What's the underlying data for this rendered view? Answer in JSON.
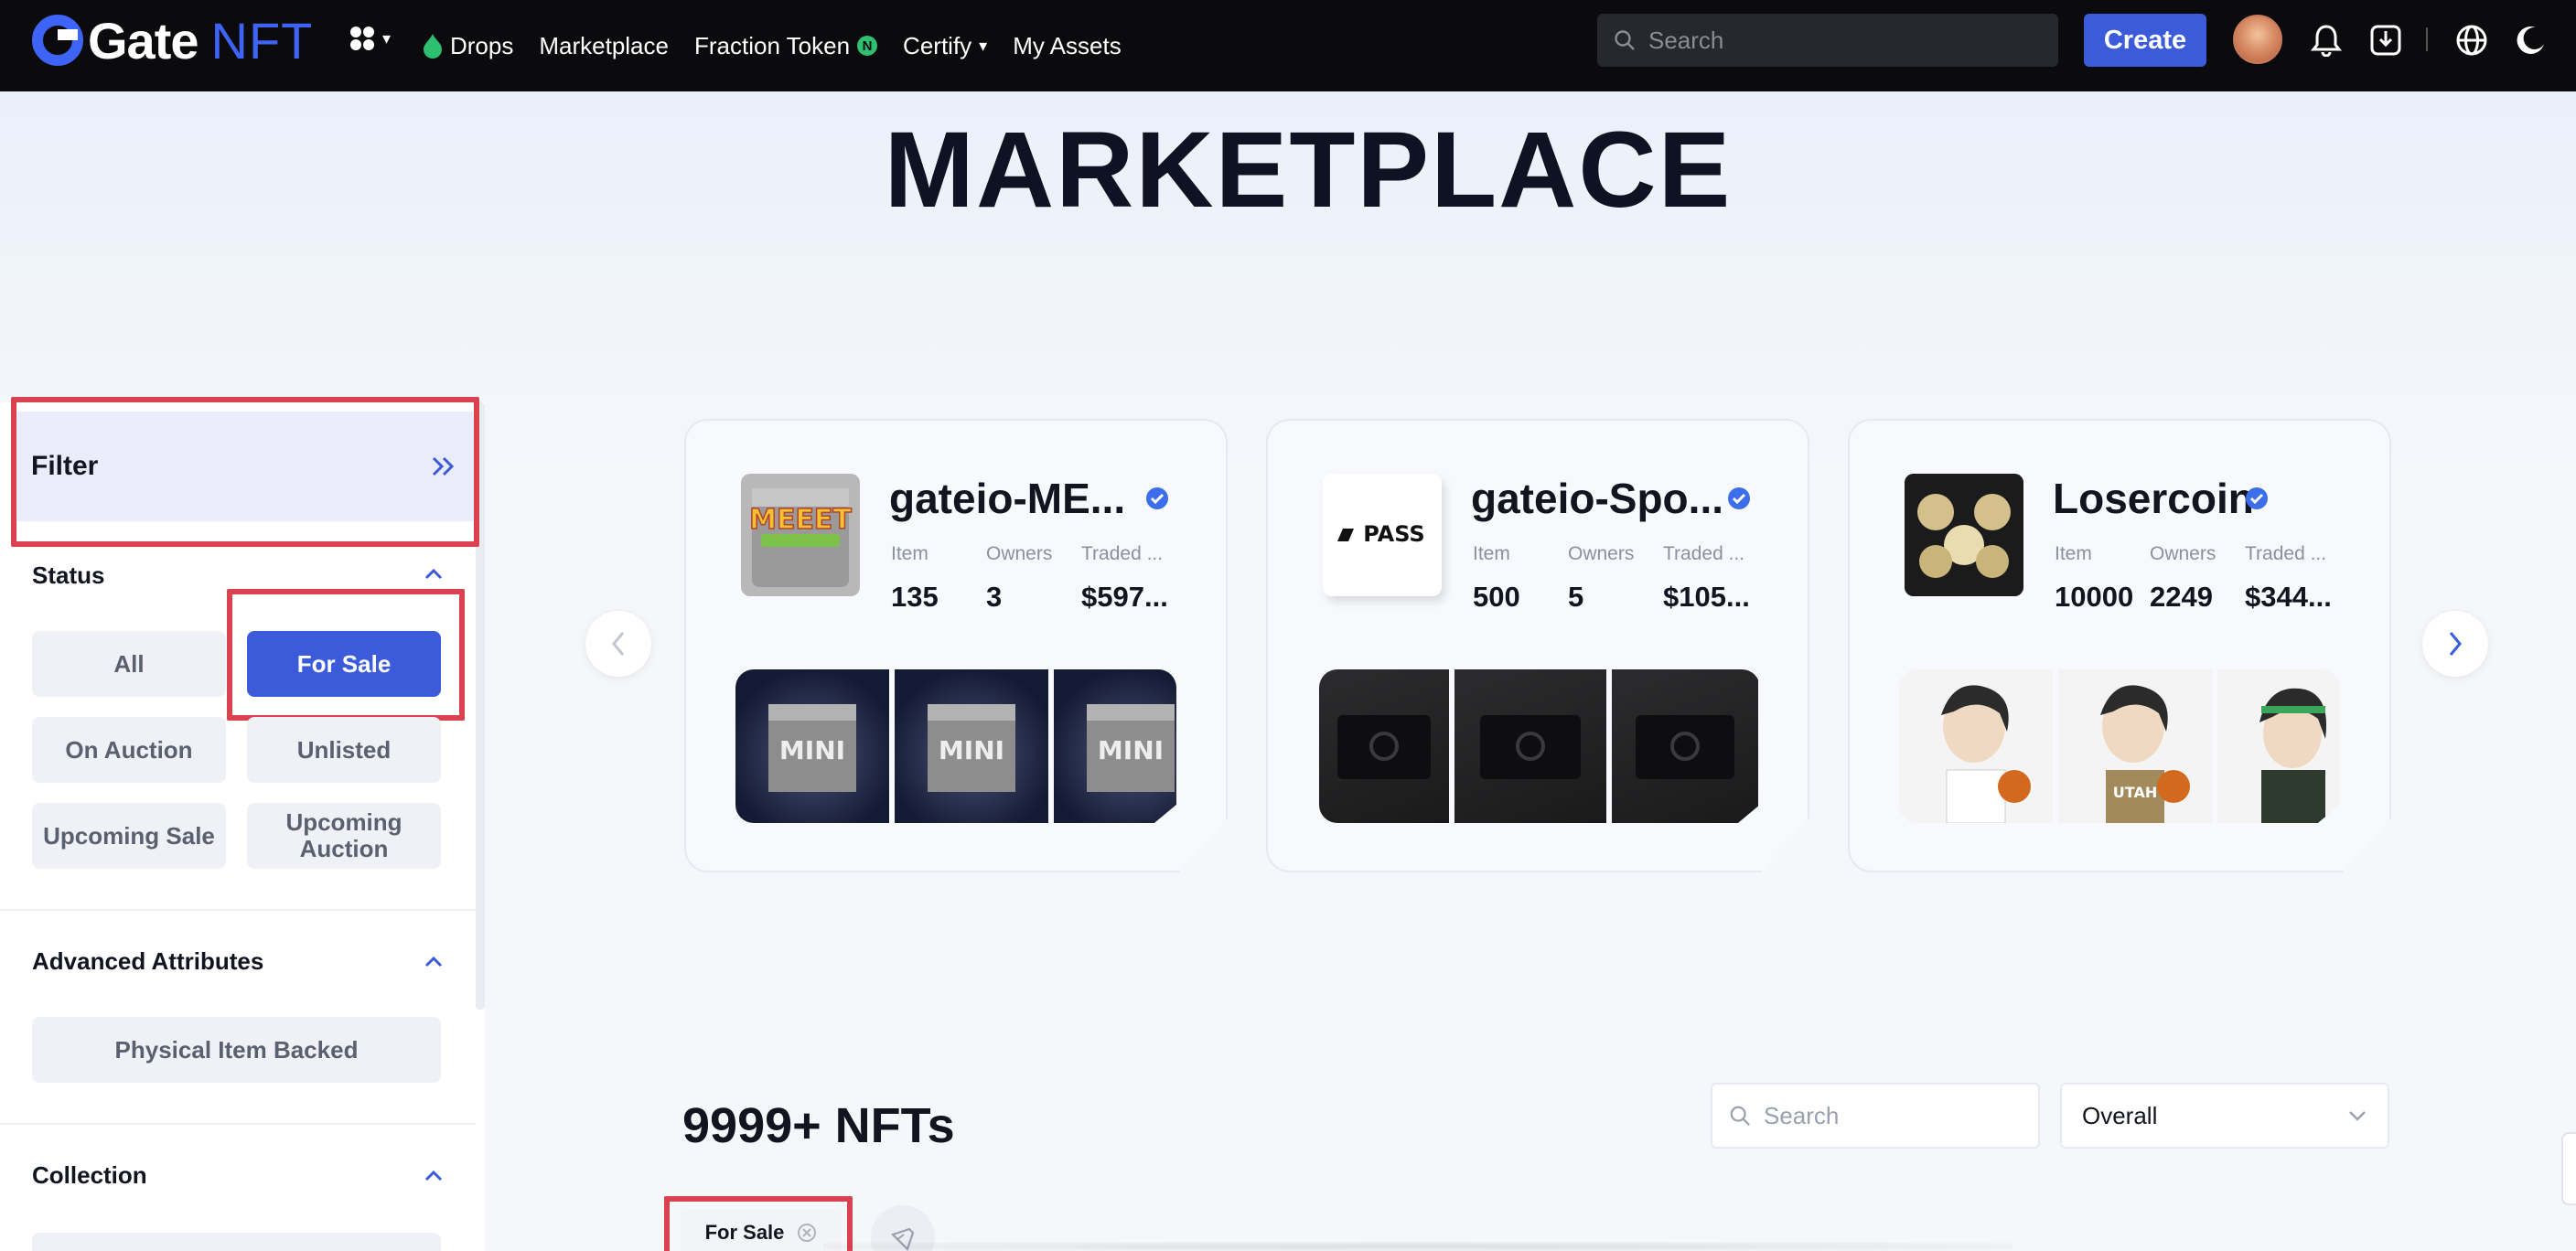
{
  "header": {
    "brand": "Gate",
    "brand_suffix": "NFT",
    "nav": [
      {
        "label": "Drops"
      },
      {
        "label": "Marketplace"
      },
      {
        "label": "Fraction Token",
        "badge": "N"
      },
      {
        "label": "Certify"
      },
      {
        "label": "My Assets"
      }
    ],
    "search_placeholder": "Search",
    "create_label": "Create",
    "icons": [
      "apps-icon",
      "drops-icon",
      "bell-icon",
      "download-icon",
      "globe-icon",
      "moon-icon",
      "search-icon"
    ]
  },
  "hero": {
    "title": "MARKETPLACE"
  },
  "sidebar": {
    "filter_title": "Filter",
    "status": {
      "title": "Status",
      "options": [
        "All",
        "For Sale",
        "On Auction",
        "Unlisted",
        "Upcoming Sale",
        "Upcoming Auction"
      ],
      "selected": "For Sale"
    },
    "advanced": {
      "title": "Advanced Attributes",
      "options": [
        "Physical Item Backed"
      ]
    },
    "collection": {
      "title": "Collection"
    }
  },
  "collections": [
    {
      "name": "gateio-ME...",
      "verified": true,
      "stats": [
        {
          "label": "Item",
          "value": "135"
        },
        {
          "label": "Owners",
          "value": "3"
        },
        {
          "label": "Traded ...",
          "value": "$597..."
        }
      ],
      "thumb_text": "MEEET",
      "strip_text": [
        "MINI",
        "MINI",
        "MINI"
      ]
    },
    {
      "name": "gateio-Spo...",
      "verified": true,
      "stats": [
        {
          "label": "Item",
          "value": "500"
        },
        {
          "label": "Owners",
          "value": "5"
        },
        {
          "label": "Traded ...",
          "value": "$105..."
        }
      ],
      "thumb_text": "PASS"
    },
    {
      "name": "Losercoin",
      "verified": true,
      "stats": [
        {
          "label": "Item",
          "value": "10000"
        },
        {
          "label": "Owners",
          "value": "2249"
        },
        {
          "label": "Traded ...",
          "value": "$344..."
        }
      ],
      "strip_text": [
        "",
        "UTAH",
        ""
      ]
    }
  ],
  "results": {
    "count": "9999+ NFTs",
    "search_placeholder": "Search",
    "sort_value": "Overall",
    "active_filters": [
      "For Sale"
    ]
  },
  "colors": {
    "accent": "#3b5bdb",
    "highlight": "#d9434f",
    "topbar": "#0b0b0d"
  }
}
